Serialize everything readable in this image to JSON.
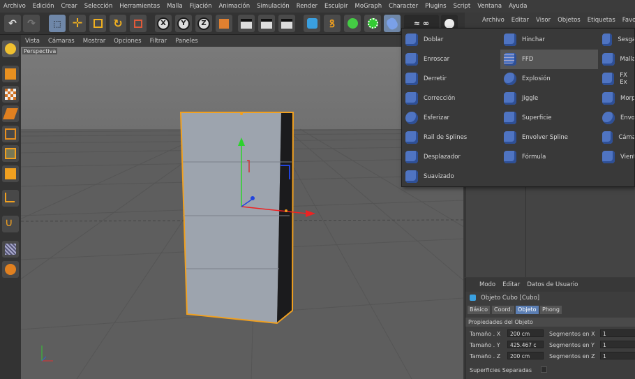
{
  "menubar": [
    "Archivo",
    "Edición",
    "Crear",
    "Selección",
    "Herramientas",
    "Malla",
    "Fijación",
    "Animación",
    "Simulación",
    "Render",
    "Esculpir",
    "MoGraph",
    "Character",
    "Plugins",
    "Script",
    "Ventana",
    "Ayuda"
  ],
  "toolbar": {
    "axis_x": "X",
    "axis_y": "Y",
    "axis_z": "Z"
  },
  "viewport": {
    "menu": [
      "Vista",
      "Cámaras",
      "Mostrar",
      "Opciones",
      "Filtrar",
      "Paneles"
    ],
    "label": "Perspectiva"
  },
  "right_panel": {
    "menu": [
      "Archivo",
      "Editar",
      "Visor",
      "Objetos",
      "Etiquetas",
      "Favori"
    ]
  },
  "deformers": {
    "col1": [
      "Doblar",
      "Enroscar",
      "Derretir",
      "Corrección",
      "Esferizar",
      "Rail de Splines",
      "Desplazador",
      "Suavizado"
    ],
    "col2": [
      "Hinchar",
      "FFD",
      "Explosión",
      "Jiggle",
      "Superficie",
      "Envolver Spline",
      "Fórmula"
    ],
    "col3": [
      "Sesga",
      "Malla",
      "FX Ex",
      "Morp",
      "Envo",
      "Cáma",
      "Vient"
    ],
    "highlighted": "FFD"
  },
  "attributes": {
    "menu": [
      "Modo",
      "Editar",
      "Datos de Usuario"
    ],
    "object_title": "Objeto Cubo [Cubo]",
    "tabs": [
      "Básico",
      "Coord.",
      "Objeto",
      "Phong"
    ],
    "active_tab": "Objeto",
    "section": "Propiedades del Objeto",
    "size_x_label": "Tamaño . X",
    "size_x": "200 cm",
    "size_y_label": "Tamaño . Y",
    "size_y": "425.467 c",
    "size_z_label": "Tamaño . Z",
    "size_z": "200 cm",
    "seg_x_label": "Segmentos en X",
    "seg_x": "1",
    "seg_y_label": "Segmentos en Y",
    "seg_y": "1",
    "seg_z_label": "Segmentos en Z",
    "seg_z": "1",
    "separate_label": "Superficies Separadas"
  },
  "colors": {
    "accent": "#5b7eb3",
    "selection_orange": "#f0a020",
    "axis_green": "#22cc22",
    "axis_red": "#dd2222",
    "axis_blue": "#2244dd"
  }
}
